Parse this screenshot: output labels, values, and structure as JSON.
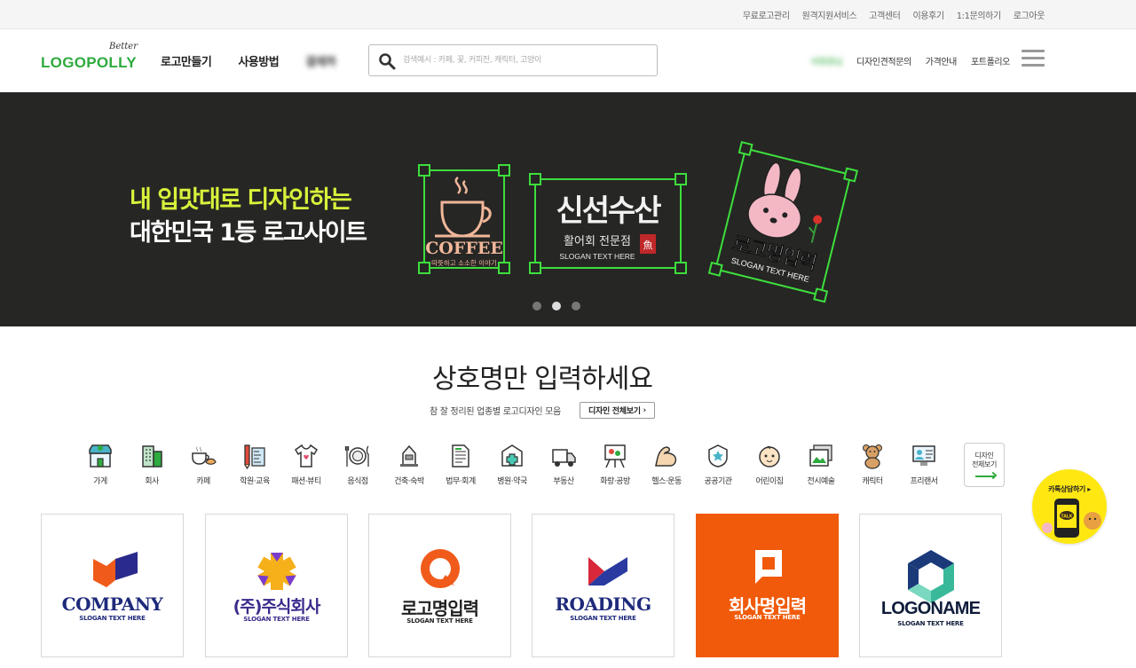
{
  "topbar": {
    "links": [
      "무료로고관리",
      "원격지원서비스",
      "고객센터",
      "이용후기",
      "1:1문의하기",
      "로그아웃"
    ]
  },
  "header": {
    "logo_small": "Better",
    "logo_main": "LOGOPOLLY",
    "nav": [
      "로고만들기",
      "사용방법",
      "결제하"
    ],
    "search_placeholder": "검색예시 : 카페, 꽃, 커피잔, 캐릭터, 고양이",
    "right_blurred": "비회원님",
    "right_links": [
      "디자인견적문의",
      "가격안내",
      "포트폴리오"
    ]
  },
  "hero": {
    "line1": "내 입맛대로 디자인하는",
    "line2": "대한민국 1등 로고사이트",
    "coffee_title": "COFFEE",
    "coffee_sub": "따뜻하고 소소한 이야기",
    "sushi_title": "신선수산",
    "sushi_sub": "활어회 전문점",
    "sushi_seal": "魚",
    "sushi_slogan": "SLOGAN TEXT HERE",
    "rabbit_title": "로고명입력",
    "rabbit_slogan": "SLOGAN TEXT HERE",
    "slides": 3,
    "active_slide": 2
  },
  "section": {
    "title": "상호명만 입력하세요",
    "subtitle": "참 잘 정리된 업종별 로고디자인 모음",
    "all_button": "디자인 전체보기"
  },
  "categories": [
    {
      "label": "가게",
      "icon": "store-icon"
    },
    {
      "label": "회사",
      "icon": "building-icon"
    },
    {
      "label": "카페",
      "icon": "coffee-croissant-icon"
    },
    {
      "label": "학원·교육",
      "icon": "pencil-ruler-icon"
    },
    {
      "label": "패션·뷰티",
      "icon": "tshirt-icon"
    },
    {
      "label": "음식점",
      "icon": "plate-cutlery-icon"
    },
    {
      "label": "건축·숙박",
      "icon": "house-icon"
    },
    {
      "label": "법무·회계",
      "icon": "document-icon"
    },
    {
      "label": "병원·약국",
      "icon": "medical-kit-icon"
    },
    {
      "label": "부동산",
      "icon": "truck-icon"
    },
    {
      "label": "화랑·공방",
      "icon": "easel-icon"
    },
    {
      "label": "헬스·운동",
      "icon": "muscle-arm-icon"
    },
    {
      "label": "공공기관",
      "icon": "badge-star-icon"
    },
    {
      "label": "어린이집",
      "icon": "baby-face-icon"
    },
    {
      "label": "전시예술",
      "icon": "picture-frame-icon"
    },
    {
      "label": "캐릭터",
      "icon": "teddy-bear-icon"
    },
    {
      "label": "프리랜서",
      "icon": "monitor-person-icon"
    }
  ],
  "category_all": {
    "line1": "디자인",
    "line2": "전체보기"
  },
  "cards": [
    {
      "name": "COMPANY",
      "slogan": "SLOGAN TEXT HERE",
      "color": "#1e2a7a"
    },
    {
      "name": "(주)주식회사",
      "slogan": "SLOGAN TEXT HERE",
      "color": "#3a2a8c"
    },
    {
      "name": "로고명입력",
      "slogan": "SLOGAN TEXT HERE",
      "color": "#222222"
    },
    {
      "name": "ROADING",
      "slogan": "SLOGAN TEXT HERE",
      "color": "#1e2a7a"
    },
    {
      "name": "회사명입력",
      "slogan": "SLOGAN TEXT HERE",
      "color": "#ffffff"
    },
    {
      "name": "LOGONAME",
      "slogan": "SLOGAN TEXT HERE",
      "color": "#0f1c3a"
    }
  ],
  "kakao": {
    "label": "카톡상담하기 ▸",
    "talk": "TALK"
  },
  "colors": {
    "brand_green": "#2eaa3e",
    "hero_bg": "#262624",
    "hero_highlight": "#d9f23b",
    "orange_card": "#f05a0a",
    "kakao_yellow": "#ffe812"
  }
}
